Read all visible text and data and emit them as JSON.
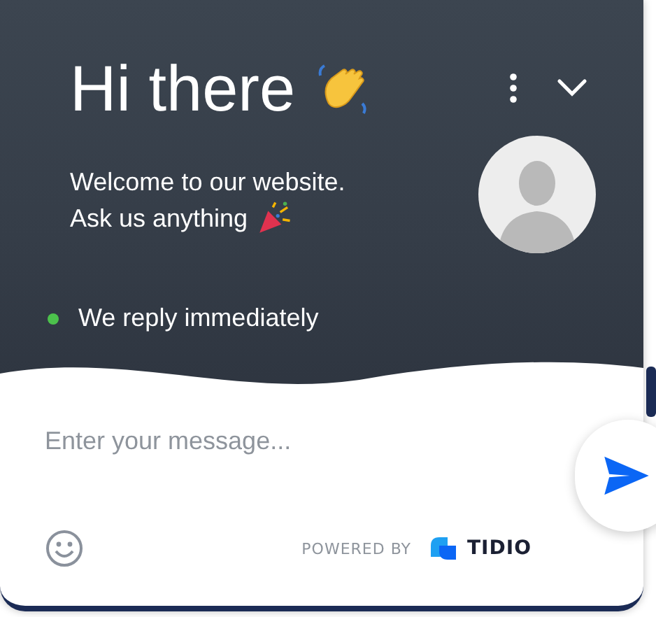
{
  "header": {
    "title": "Hi there",
    "welcome_lines": [
      "Welcome to our website.",
      "Ask us anything"
    ]
  },
  "status": {
    "text": "We reply immediately",
    "online": true
  },
  "composer": {
    "placeholder": "Enter your message..."
  },
  "footer": {
    "powered_by": "POWERED BY",
    "brand": "TIDIO"
  }
}
